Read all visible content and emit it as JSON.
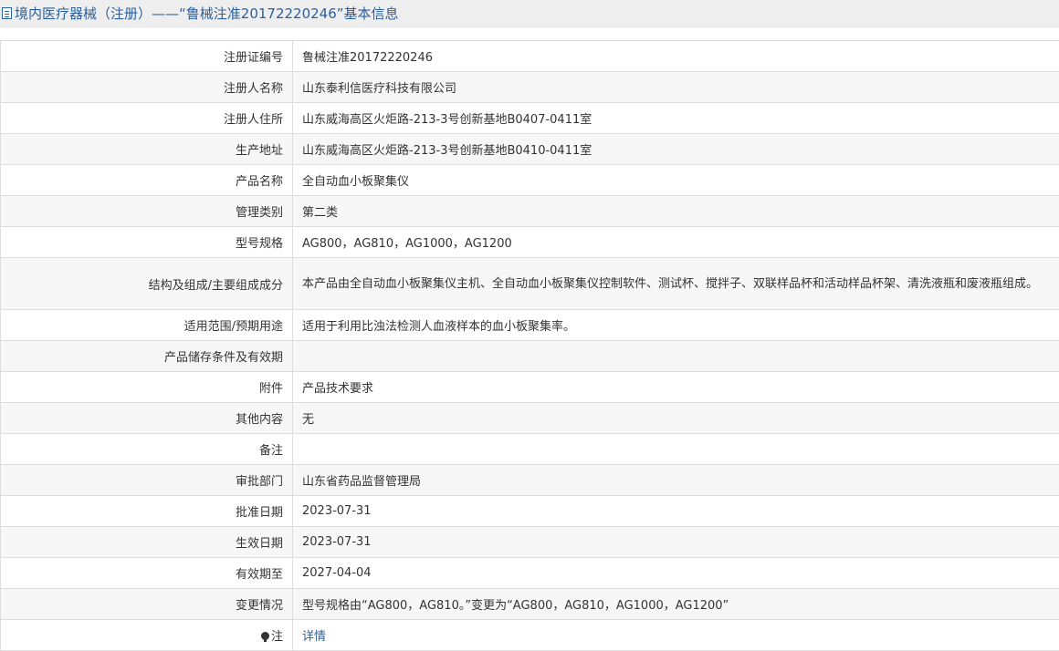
{
  "page_title": "境内医疗器械（注册）——“鲁械注准20172220246”基本信息",
  "rows": [
    {
      "label": "注册证编号",
      "value": "鲁械注准20172220246"
    },
    {
      "label": "注册人名称",
      "value": "山东泰利信医疗科技有限公司"
    },
    {
      "label": "注册人住所",
      "value": "山东威海高区火炬路-213-3号创新基地B0407-0411室"
    },
    {
      "label": "生产地址",
      "value": "山东威海高区火炬路-213-3号创新基地B0410-0411室"
    },
    {
      "label": "产品名称",
      "value": "全自动血小板聚集仪"
    },
    {
      "label": "管理类别",
      "value": "第二类"
    },
    {
      "label": "型号规格",
      "value": "AG800，AG810，AG1000，AG1200"
    },
    {
      "label": "结构及组成/主要组成成分",
      "value": "本产品由全自动血小板聚集仪主机、全自动血小板聚集仪控制软件、测试杯、搅拌子、双联样品杯和活动样品杯架、清洗液瓶和废液瓶组成。"
    },
    {
      "label": "适用范围/预期用途",
      "value": "适用于利用比浊法检测人血液样本的血小板聚集率。"
    },
    {
      "label": "产品储存条件及有效期",
      "value": ""
    },
    {
      "label": "附件",
      "value": "产品技术要求"
    },
    {
      "label": "其他内容",
      "value": "无"
    },
    {
      "label": "备注",
      "value": ""
    },
    {
      "label": "审批部门",
      "value": "山东省药品监督管理局"
    },
    {
      "label": "批准日期",
      "value": "2023-07-31"
    },
    {
      "label": "生效日期",
      "value": "2023-07-31"
    },
    {
      "label": "有效期至",
      "value": "2027-04-04"
    },
    {
      "label": "变更情况",
      "value": "型号规格由“AG800，AG810。”变更为“AG800，AG810，AG1000，AG1200”"
    }
  ],
  "note_row": {
    "label": "注",
    "link": "详情",
    "icon": "bulb-icon"
  }
}
